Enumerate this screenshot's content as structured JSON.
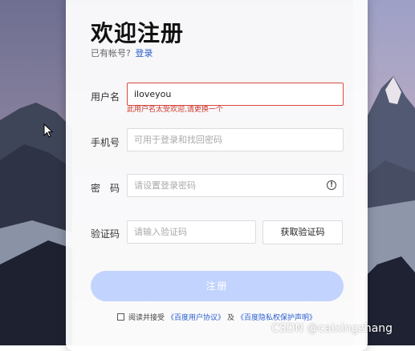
{
  "page": {
    "title": "欢迎注册",
    "has_account_text": "已有帐号?",
    "login_link": "登录"
  },
  "form": {
    "username_label": "用户名",
    "username_value": "iloveyou",
    "username_error": "此用户名太受欢迎,请更换一个",
    "phone_label": "手机号",
    "phone_placeholder": "可用于登录和找回密码",
    "password_label": "密　码",
    "password_placeholder": "请设置登录密码",
    "password_info_icon": "info-icon",
    "code_label": "验证码",
    "code_placeholder": "请输入验证码",
    "get_code_button": "获取验证码",
    "submit_button": "注册"
  },
  "agreement": {
    "prefix": "阅读并接受",
    "terms_link": "《百度用户协议》",
    "and": "及",
    "privacy_link": "《百度隐私权保护声明》"
  },
  "watermark": "CSDN @caixingzhang",
  "colors": {
    "error": "#d94a3e",
    "link": "#2a5fcf",
    "submit_disabled": "#c2d4fd"
  }
}
